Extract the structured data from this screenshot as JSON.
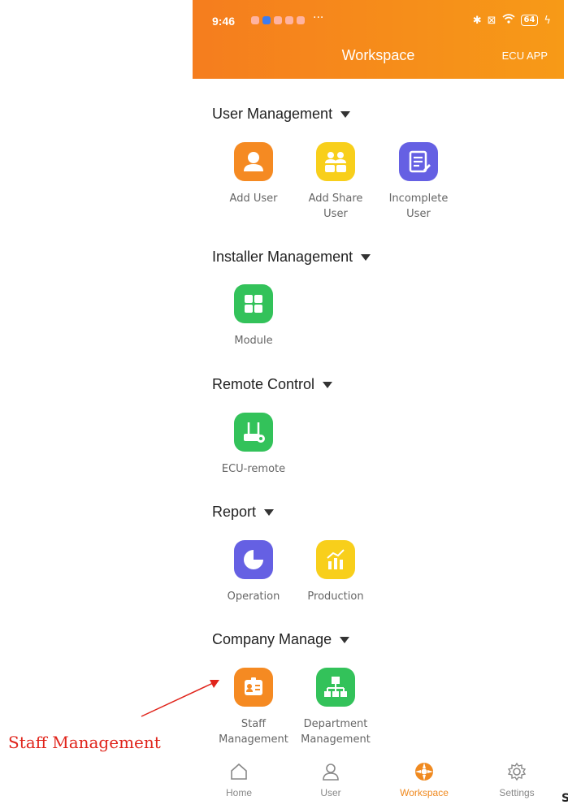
{
  "status": {
    "time": "9:46",
    "dots": "···",
    "battery": "64"
  },
  "header": {
    "title": "Workspace",
    "right_label": "ECU APP"
  },
  "sections": [
    {
      "title": "User Management",
      "items": [
        {
          "label": "Add User",
          "icon": "add-user-icon",
          "color": "#f58a22"
        },
        {
          "label": "Add Share User",
          "icon": "share-user-icon",
          "color": "#f8cf1b"
        },
        {
          "label": "Incomplete User",
          "icon": "document-edit-icon",
          "color": "#6560e3"
        }
      ]
    },
    {
      "title": "Installer Management",
      "items": [
        {
          "label": "Module",
          "icon": "grid-icon",
          "color": "#33c25a"
        }
      ]
    },
    {
      "title": "Remote Control",
      "items": [
        {
          "label": "ECU-remote",
          "icon": "router-icon",
          "color": "#33c25a"
        }
      ]
    },
    {
      "title": "Report",
      "items": [
        {
          "label": "Operation",
          "icon": "pie-chart-icon",
          "color": "#6560e3"
        },
        {
          "label": "Production",
          "icon": "bar-chart-icon",
          "color": "#f8cf1b"
        }
      ]
    },
    {
      "title": "Company Manage",
      "items": [
        {
          "label": "Staff Management",
          "icon": "id-badge-icon",
          "color": "#f58a22"
        },
        {
          "label": "Department Management",
          "icon": "org-chart-icon",
          "color": "#33c25a"
        }
      ]
    }
  ],
  "tabs": [
    {
      "label": "Home",
      "icon": "home-icon"
    },
    {
      "label": "User",
      "icon": "user-icon"
    },
    {
      "label": "Workspace",
      "icon": "workspace-icon",
      "active": true
    },
    {
      "label": "Settings",
      "icon": "gear-icon"
    }
  ],
  "annotation": {
    "text": "Staff Management",
    "edge_char": "S"
  }
}
